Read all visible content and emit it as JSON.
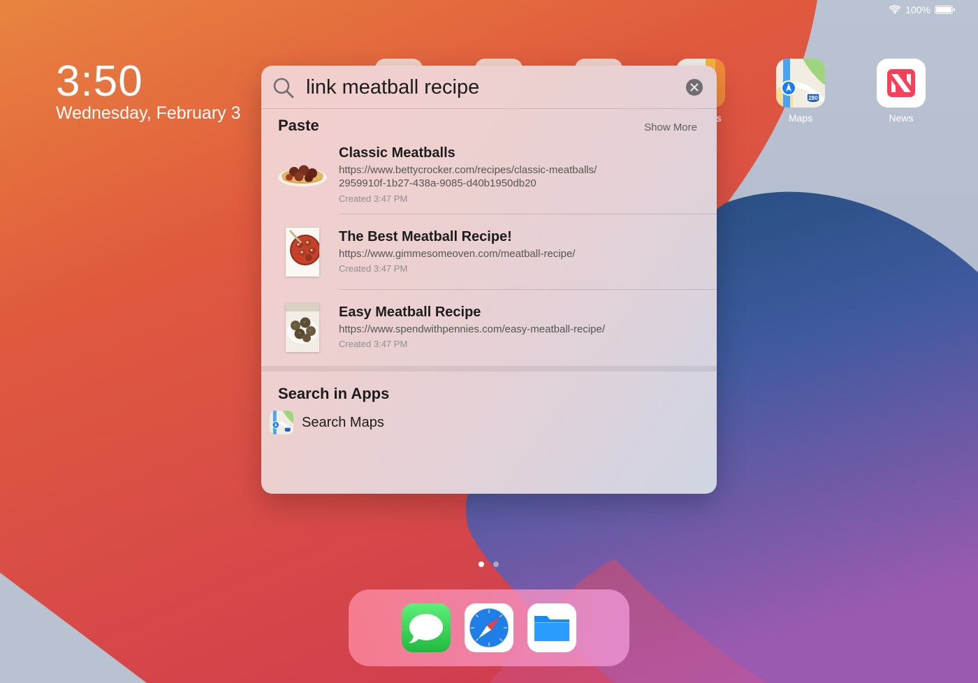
{
  "status_bar": {
    "battery": "100%",
    "battery_level": 1.0
  },
  "clock": {
    "time": "3:50",
    "date": "Wednesday, February 3"
  },
  "home_apps": [
    {
      "name": "Maps",
      "icon": "maps-icon"
    },
    {
      "name": "News",
      "icon": "news-icon"
    }
  ],
  "partial_label": "s",
  "spotlight": {
    "query": "link meatball recipe",
    "paste_section": {
      "title": "Paste",
      "show_more": "Show More",
      "results": [
        {
          "title": "Classic Meatballs",
          "url_line1": "https://www.bettycrocker.com/recipes/classic-meatballs/",
          "url_line2": "2959910f-1b27-438a-9085-d40b1950db20",
          "meta": "Created 3:47 PM",
          "thumbnail": "meatballs-spaghetti-thumbnail"
        },
        {
          "title": "The Best Meatball Recipe!",
          "url_line1": "https://www.gimmesomeoven.com/meatball-recipe/",
          "meta": "Created 3:47 PM",
          "thumbnail": "meatballs-in-sauce-thumbnail"
        },
        {
          "title": "Easy Meatball Recipe",
          "url_line1": "https://www.spendwithpennies.com/easy-meatball-recipe/",
          "meta": "Created 3:47 PM",
          "thumbnail": "meatballs-plate-thumbnail"
        }
      ]
    },
    "apps_section": {
      "title": "Search in Apps",
      "item_label": "Search Maps",
      "item_icon": "maps-icon"
    }
  },
  "page_dots": {
    "count": 2,
    "active": 1
  },
  "dock": [
    {
      "app": "Messages",
      "icon": "messages-icon"
    },
    {
      "app": "Safari",
      "icon": "safari-icon"
    },
    {
      "app": "Files",
      "icon": "files-icon"
    }
  ],
  "colors": {
    "wallpaper_orange": "#e8843f",
    "wallpaper_red": "#d94545",
    "wallpaper_blue": "#2d5b8f",
    "wallpaper_purple": "#8a5aa8",
    "accent_news": "#fa3f5b",
    "messages_green": "#34c759",
    "files_blue": "#1a8cf0"
  }
}
